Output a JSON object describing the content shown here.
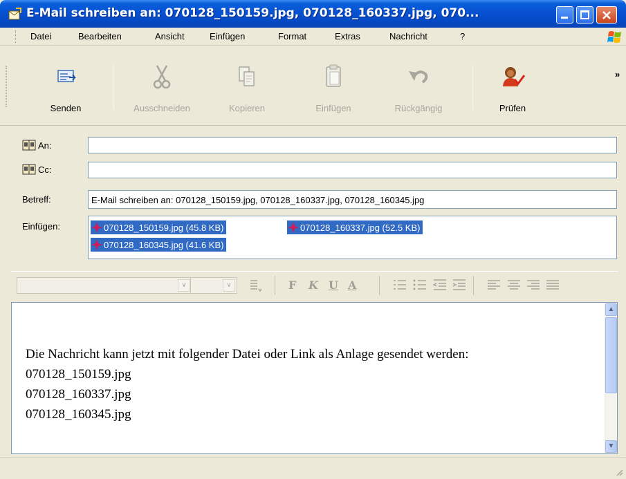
{
  "window": {
    "title": "E-Mail schreiben an: 070128_150159.jpg, 070128_160337.jpg, 070...",
    "colors": {
      "titlebar": "#0650d0",
      "selection": "#316ac5",
      "chrome": "#ece9d8"
    }
  },
  "menu": {
    "items": [
      "Datei",
      "Bearbeiten",
      "Ansicht",
      "Einfügen",
      "Format",
      "Extras",
      "Nachricht",
      "?"
    ]
  },
  "toolbar": {
    "buttons": [
      {
        "label": "Senden",
        "icon": "send-icon",
        "enabled": true
      },
      {
        "label": "Ausschneiden",
        "icon": "scissors-icon",
        "enabled": false
      },
      {
        "label": "Kopieren",
        "icon": "copy-icon",
        "enabled": false
      },
      {
        "label": "Einfügen",
        "icon": "paste-icon",
        "enabled": false
      },
      {
        "label": "Rückgängig",
        "icon": "undo-icon",
        "enabled": false
      },
      {
        "label": "Prüfen",
        "icon": "check-names-icon",
        "enabled": true
      }
    ],
    "overflow": "»"
  },
  "header": {
    "to_label": "An:",
    "to_value": "",
    "cc_label": "Cc:",
    "cc_value": "",
    "subject_label": "Betreff:",
    "subject_value": "E-Mail schreiben an: 070128_150159.jpg, 070128_160337.jpg, 070128_160345.jpg",
    "attach_label": "Einfügen:",
    "attachments": [
      "070128_150159.jpg (45.8 KB)",
      "070128_160337.jpg (52.5 KB)",
      "070128_160345.jpg (41.6 KB)"
    ]
  },
  "formatbar": {
    "font_value": "",
    "size_value": "",
    "buttons": [
      "paragraph-style-icon",
      "bold-icon",
      "italic-icon",
      "underline-icon",
      "font-color-icon",
      "numbered-list-icon",
      "bullet-list-icon",
      "decrease-indent-icon",
      "increase-indent-icon",
      "align-left-icon",
      "align-center-icon",
      "align-right-icon",
      "justify-icon"
    ],
    "bold_glyph": "F",
    "italic_glyph": "K",
    "underline_glyph": "U",
    "color_glyph": "A"
  },
  "body": {
    "lines": [
      "Die Nachricht kann jetzt mit folgender Datei oder Link als Anlage gesendet werden:",
      "070128_150159.jpg",
      "070128_160337.jpg",
      "070128_160345.jpg"
    ]
  }
}
